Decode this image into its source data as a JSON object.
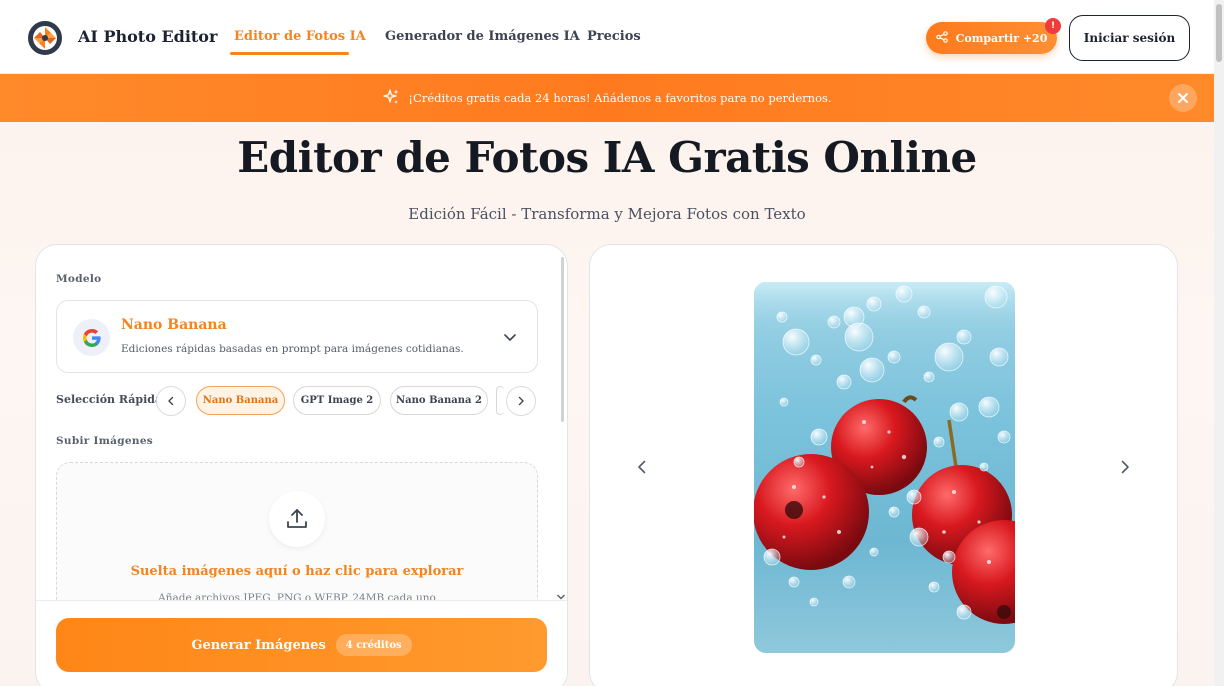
{
  "nav": {
    "brand": "AI Photo Editor",
    "links": [
      {
        "label": "Editor de Fotos IA",
        "active": true
      },
      {
        "label": "Generador de Imágenes IA",
        "active": false
      },
      {
        "label": "Precios",
        "active": false
      }
    ],
    "share_label": "Compartir +20",
    "share_badge": "!",
    "login_label": "Iniciar sesión"
  },
  "banner": {
    "icon": "sparkles-icon",
    "text": "¡Créditos gratis cada 24 horas! Añádenos a favoritos para no perdernos."
  },
  "hero": {
    "title": "Editor de Fotos IA Gratis Online",
    "subtitle": "Edición Fácil - Transforma y Mejora Fotos con Texto"
  },
  "editor": {
    "model_section_label": "Modelo",
    "model": {
      "name": "Nano Banana",
      "description": "Ediciones rápidas basadas en prompt para imágenes cotidianas."
    },
    "quick_select_label": "Selección Rápida:",
    "quick_chips": [
      {
        "label": "Nano Banana",
        "active": true
      },
      {
        "label": "GPT Image 2",
        "active": false
      },
      {
        "label": "Nano Banana 2",
        "active": false
      }
    ],
    "upload_section_label": "Subir Imágenes",
    "dropzone": {
      "title": "Suelta imágenes aquí o haz clic para explorar",
      "subtitle": "Añade archivos JPEG, PNG o WEBP, 24MB cada uno"
    },
    "generate_label": "Generar Imágenes",
    "generate_credits": "4 créditos"
  },
  "colors": {
    "accent": "#f5841f",
    "banner": "#ff7a1e",
    "text_dark": "#151922"
  }
}
